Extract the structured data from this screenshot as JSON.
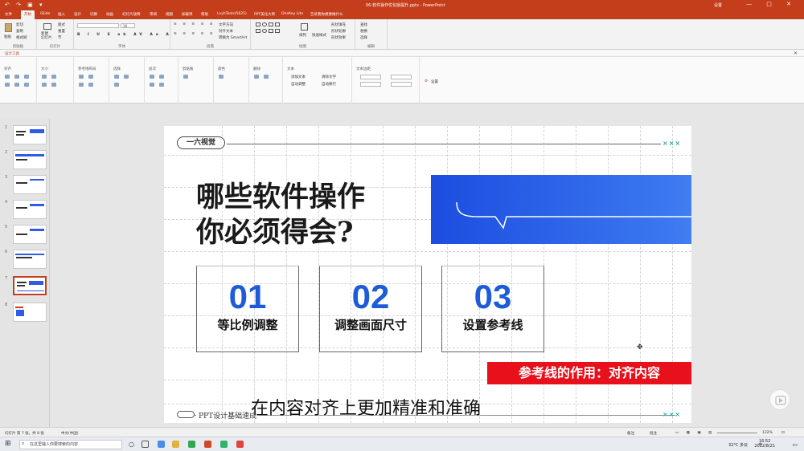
{
  "window": {
    "quick_access": "↶ ↷ ▣ ▾",
    "title": "06-软件操作优化版提升.pptx - PowerPoint",
    "user": "设置",
    "controls": "— □ ✕"
  },
  "tabs": [
    "文件",
    "开始",
    "iSlide",
    "插入",
    "设计",
    "切换",
    "动画",
    "幻灯片放映",
    "审阅",
    "视图",
    "加载项",
    "帮助",
    "LvyhTools(5625)",
    "PPT美化大师",
    "OneKey Lite",
    "告诉我你想要做什么"
  ],
  "ribbon": {
    "clipboard": {
      "label": "剪贴板",
      "paste": "粘贴",
      "cut": "剪切",
      "copy": "复制",
      "format": "格式刷"
    },
    "slides": {
      "label": "幻灯片",
      "new": "新建\n幻灯片",
      "layout": "版式",
      "reset": "重置",
      "section": "节"
    },
    "font": {
      "label": "字体",
      "size": "16"
    },
    "paragraph": {
      "label": "段落",
      "dir": "文字方向",
      "align": "对齐文本",
      "smartart": "转换为 SmartArt"
    },
    "drawing": {
      "label": "绘图",
      "arrange": "排列",
      "styles": "快速样式",
      "fill": "形状填充",
      "outline": "形状轮廓",
      "effect": "形状效果"
    },
    "editing": {
      "label": "编辑",
      "find": "查找",
      "replace": "替换",
      "select": "选择"
    }
  },
  "subbar": {
    "label": "设计工具"
  },
  "tools": {
    "groups": [
      "对齐",
      "大小",
      "参考线布局",
      "选择",
      "层次",
      "剪贴板",
      "颜色",
      "删除",
      "文本",
      "文本边距"
    ],
    "text_items": [
      "添加文本",
      "清除文字",
      "自动调整",
      "自动换行"
    ],
    "settings": "设置"
  },
  "thumbnails": [
    "1",
    "2",
    "3",
    "4",
    "5",
    "6",
    "7",
    "8"
  ],
  "slide": {
    "brand": "一六视觉",
    "xx": "×××",
    "heading1": "哪些软件操作",
    "heading2": "你必须得会?",
    "cards": [
      {
        "num": "01",
        "label": "等比例调整"
      },
      {
        "num": "02",
        "label": "调整画面尺寸"
      },
      {
        "num": "03",
        "label": "设置参考线"
      }
    ],
    "footer": "PPT设计基础速成"
  },
  "caption": {
    "red": "参考线的作用：对齐内容",
    "subtitle": "在内容对齐上更加精准和准确"
  },
  "status": {
    "slide": "幻灯片 第 7 张，共 8 张",
    "lang": "中文(中国)",
    "notes": "备注",
    "comments": "批注",
    "zoom": "132%"
  },
  "taskbar": {
    "search": "在这里输入你要搜索的内容",
    "weather": "32°C 多云",
    "ime": "中",
    "time": "16:52",
    "date": "2022/8/21"
  },
  "colors": {
    "accent": "#c43e1c",
    "blue": "#1e5bd8",
    "red": "#e8101a"
  }
}
